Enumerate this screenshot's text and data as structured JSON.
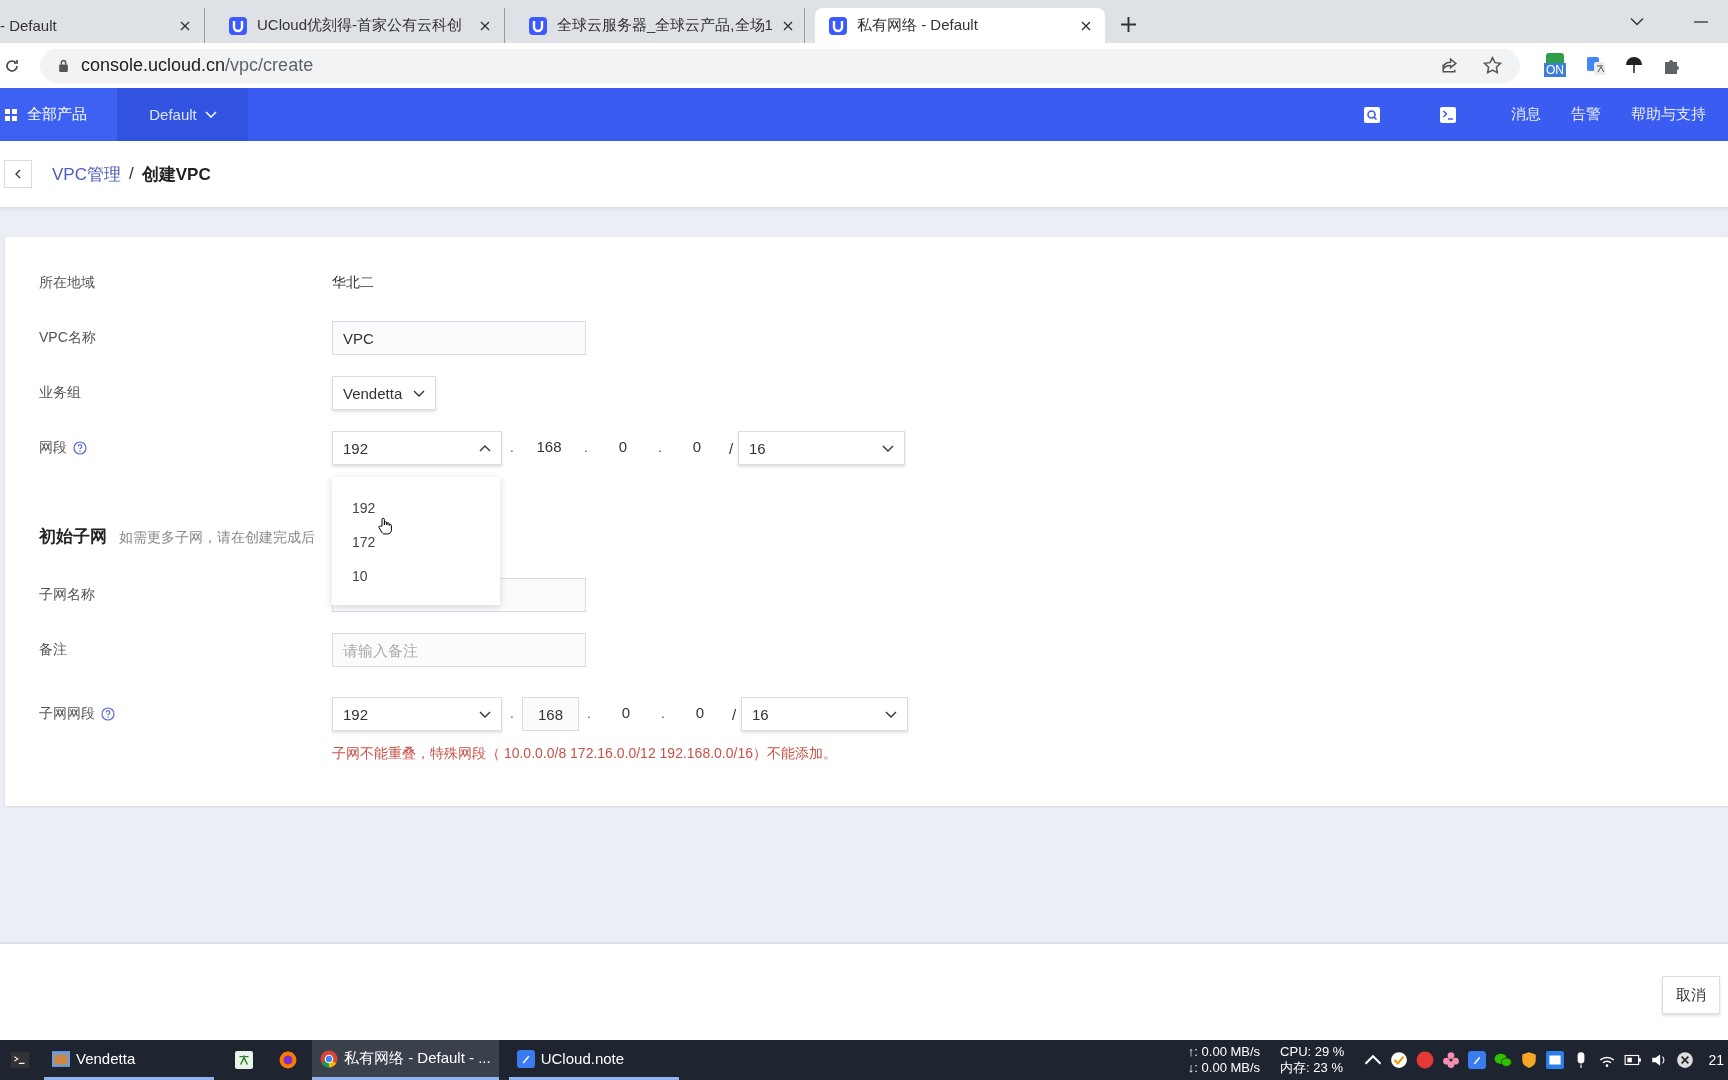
{
  "browser": {
    "tabs": [
      {
        "title": "- Default",
        "kind": "plain",
        "selected": false
      },
      {
        "title": "UCloud优刻得-首家公有云科创",
        "kind": "ucloud",
        "selected": false
      },
      {
        "title": "全球云服务器_全球云产品,全场1",
        "kind": "ucloud",
        "selected": false
      },
      {
        "title": "私有网络 - Default",
        "kind": "ucloud",
        "selected": true
      }
    ],
    "address": {
      "host": "console.ucloud.cn",
      "path": "/vpc/create"
    },
    "extension_badge": "ON"
  },
  "header": {
    "products": "全部产品",
    "project": "Default",
    "links": [
      "消息",
      "告警",
      "帮助与支持"
    ]
  },
  "breadcrumb": {
    "parent": "VPC管理",
    "separator": "/",
    "current": "创建VPC"
  },
  "vpc": {
    "region_label": "所在地域",
    "region": "华北二",
    "name_label": "VPC名称",
    "name": "VPC",
    "group_label": "业务组",
    "group": "Vendetta",
    "cidr_label": "网段",
    "cidr": {
      "first": "192",
      "expanded": true,
      "octets": [
        {
          "dot": ".",
          "value": "168",
          "kind": "text"
        },
        {
          "dot": ".",
          "value": "0",
          "kind": "text"
        },
        {
          "dot": ".",
          "value": "0",
          "kind": "text"
        }
      ],
      "slash": "/",
      "mask": "16"
    },
    "options": [
      "192",
      "172",
      "10"
    ]
  },
  "subnet": {
    "title": "初始子网",
    "hint": "如需更多子网，请在创建完成后",
    "name_label": "子网名称",
    "remark_label": "备注",
    "remark_placeholder": "请输入备注",
    "cidr_label": "子网网段",
    "cidr": {
      "first": "192",
      "expanded": false,
      "octets": [
        {
          "dot": ".",
          "value": "168",
          "kind": "input"
        },
        {
          "dot": ".",
          "value": "0",
          "kind": "text"
        },
        {
          "dot": ".",
          "value": "0",
          "kind": "text"
        }
      ],
      "slash": "/",
      "mask": "16"
    },
    "error": "子网不能重叠，特殊网段（ 10.0.0.0/8 172.16.0.0/12 192.168.0.0/16）不能添加。"
  },
  "footer": {
    "cancel": "取消"
  },
  "taskbar": {
    "apps": [
      {
        "label": "Vendetta",
        "kind": "vendetta",
        "selected": false
      },
      {
        "label": "私有网络 - Default - ...",
        "kind": "chrome",
        "selected": true
      },
      {
        "label": "UCloud.note",
        "kind": "note",
        "selected": false
      }
    ],
    "net": [
      "↑: 0.00 MB/s",
      "↓: 0.00 MB/s"
    ],
    "cpu": "CPU: 29 %",
    "mem": "内存: 23 %",
    "clock": "21"
  }
}
